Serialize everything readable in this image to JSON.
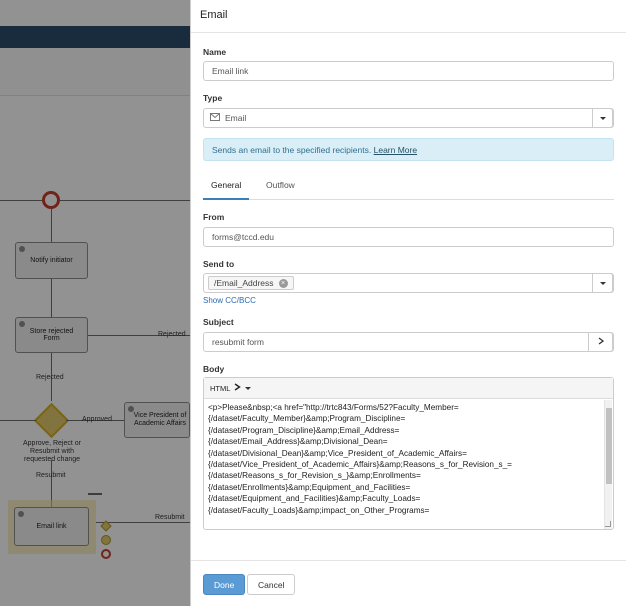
{
  "panel": {
    "title": "Email",
    "name_label": "Name",
    "name_value": "Email link",
    "type_label": "Type",
    "type_value": "Email",
    "info_text": "Sends an email to the specified recipients.",
    "info_link": "Learn More",
    "tabs": [
      {
        "label": "General",
        "active": true
      },
      {
        "label": "Outflow",
        "active": false
      }
    ],
    "from_label": "From",
    "from_value": "forms@tccd.edu",
    "send_to_label": "Send to",
    "send_to_token": "/Email_Address",
    "show_cc_label": "Show CC/BCC",
    "subject_label": "Subject",
    "subject_value": "resubmit form",
    "body_label": "Body",
    "body_mode": "HTML",
    "body_lines": [
      "<p>Please&nbsp;<a href=\"http://trtc843/Forms/52?Faculty_Member=",
      "{/dataset/Faculty_Member}&amp;Program_Discipline=",
      "{/dataset/Program_Discipline}&amp;Email_Address=",
      "{/dataset/Email_Address}&amp;Divisional_Dean=",
      "{/dataset/Divisional_Dean}&amp;Vice_President_of_Academic_Affairs=",
      "{/dataset/Vice_President_of_Academic_Affairs}&amp;Reasons_s_for_Revision_s_=",
      "{/dataset/Reasons_s_for_Revision_s_}&amp;Enrollments=",
      "{/dataset/Enrollments}&amp;Equipment_and_Facilities=",
      "{/dataset/Equipment_and_Facilities}&amp;Faculty_Loads=",
      "{/dataset/Faculty_Loads}&amp;impact_on_Other_Programs="
    ],
    "done_label": "Done",
    "cancel_label": "Cancel"
  },
  "workflow": {
    "notify_initiator": "Notify initiator",
    "store_rejected": "Store rejected Form",
    "rejected_1": "Rejected",
    "rejected_2": "Rejected",
    "approve_reject": "Approve, Reject or Resubmit with requested change",
    "approved": "Approved",
    "vice_president": "Vice President of Academic Affairs",
    "resubmit_1": "Resubmit",
    "resubmit_2": "Resubmit",
    "email_link": "Email link"
  },
  "colors": {
    "accent": "#5b9bd5",
    "info_bg": "#d9eef7",
    "topbar": "#2b4a66",
    "end_event": "#c0392b",
    "gateway": "#e8c12a"
  }
}
